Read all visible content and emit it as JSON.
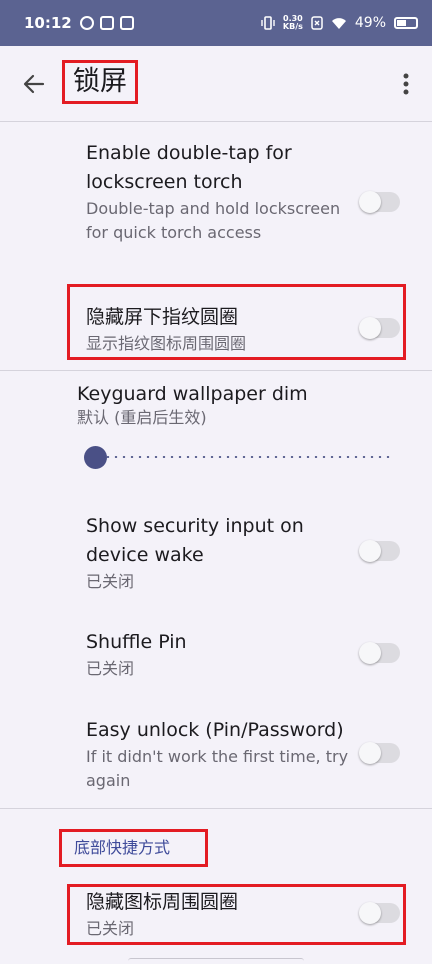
{
  "status_bar": {
    "time": "10:12",
    "speed_top": "0.30",
    "speed_bottom": "KB/s",
    "battery": "49%"
  },
  "app_bar": {
    "title": "锁屏"
  },
  "settings": [
    {
      "title": "Enable double-tap for lockscreen torch",
      "subtitle": "Double-tap and hold lockscreen for quick torch access",
      "enabled": false
    },
    {
      "title": "隐藏屏下指纹圆圈",
      "subtitle": "显示指纹图标周围圆圈",
      "enabled": false
    },
    {
      "title": "Show security input on device wake",
      "subtitle": "已关闭",
      "enabled": false
    },
    {
      "title": "Shuffle Pin",
      "subtitle": "已关闭",
      "enabled": false
    },
    {
      "title": "Easy unlock (Pin/Password)",
      "subtitle": "If it didn't work the first time, try again",
      "enabled": false
    }
  ],
  "slider": {
    "title": "Keyguard wallpaper dim",
    "subtitle": "默认 (重启后生效)",
    "value": 0
  },
  "section": {
    "header": "底部快捷方式",
    "items": [
      {
        "title": "隐藏图标周围圆圈",
        "subtitle": "已关闭",
        "enabled": false
      }
    ]
  },
  "colors": {
    "status_bar": "#5b6391",
    "background": "#f4f2f9",
    "accent": "#4a5086",
    "highlight_box": "#e31c23"
  }
}
